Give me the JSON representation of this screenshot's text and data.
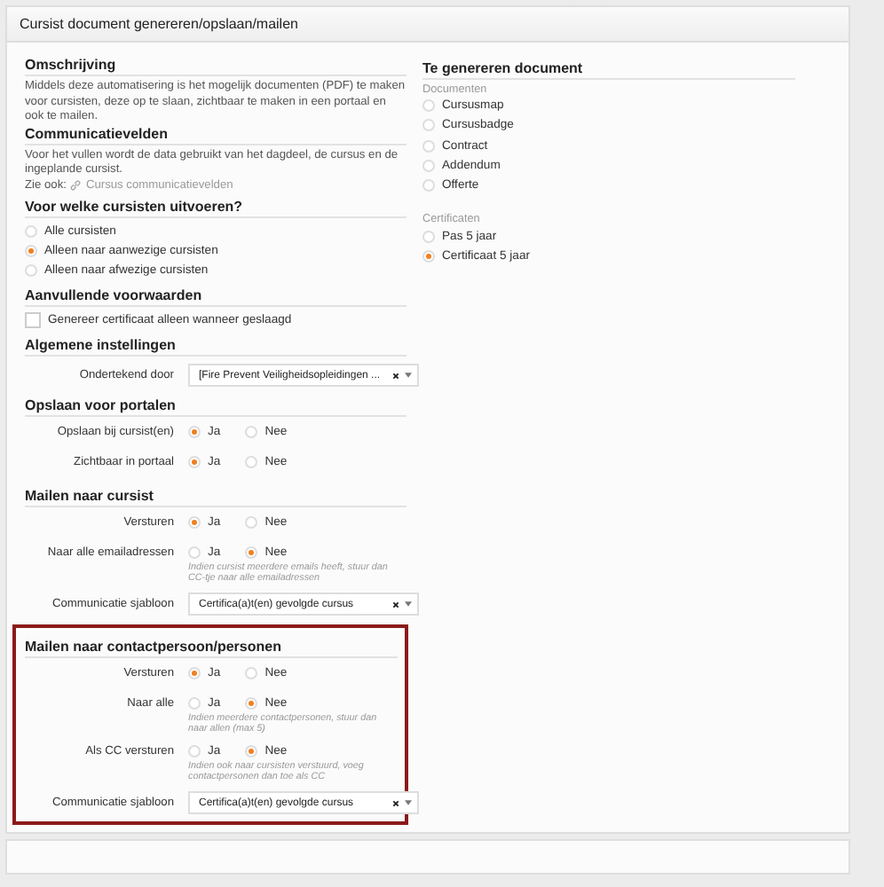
{
  "panel": {
    "title": "Cursist document genereren/opslaan/mailen"
  },
  "left": [
    {
      "kind": "text",
      "heading": "Omschrijving",
      "paragraph": "Middels deze automatisering is het mogelijk documenten (PDF) te maken voor cursisten, deze op te slaan, zichtbaar te maken in een portaal en ook te mailen."
    },
    {
      "kind": "text",
      "heading": "Communicatievelden",
      "paragraph": "Voor het vullen wordt de data gebruikt van het dagdeel, de cursus en de ingeplande cursist.",
      "see_also": {
        "label": "Zie ook:",
        "link": "Cursus communicatievelden"
      }
    },
    {
      "kind": "radios",
      "heading": "Voor welke cursisten uitvoeren?",
      "options": [
        {
          "label": "Alle cursisten",
          "selected": false
        },
        {
          "label": "Alleen naar aanwezige cursisten",
          "selected": true
        },
        {
          "label": "Alleen naar afwezige cursisten",
          "selected": false
        }
      ]
    },
    {
      "kind": "checkboxes",
      "heading": "Aanvullende voorwaarden",
      "items": [
        {
          "label": "Genereer certificaat alleen wanneer geslaagd",
          "checked": false
        }
      ]
    },
    {
      "kind": "form",
      "heading": "Algemene instellingen",
      "rows": [
        {
          "kind": "select",
          "label": "Ondertekend door",
          "value": "[Fire Prevent Veiligheidsopleidingen ..."
        }
      ]
    },
    {
      "kind": "form",
      "heading": "Opslaan voor portalen",
      "rows": [
        {
          "kind": "yesno",
          "label": "Opslaan bij cursist(en)",
          "options": [
            {
              "label": "Ja",
              "selected": true
            },
            {
              "label": "Nee",
              "selected": false
            }
          ]
        },
        {
          "kind": "yesno",
          "label": "Zichtbaar in portaal",
          "options": [
            {
              "label": "Ja",
              "selected": true
            },
            {
              "label": "Nee",
              "selected": false
            }
          ]
        }
      ]
    },
    {
      "kind": "form",
      "heading": "Mailen naar cursist",
      "rows": [
        {
          "kind": "yesno",
          "label": "Versturen",
          "options": [
            {
              "label": "Ja",
              "selected": true
            },
            {
              "label": "Nee",
              "selected": false
            }
          ]
        },
        {
          "kind": "yesno",
          "label": "Naar alle emailadressen",
          "options": [
            {
              "label": "Ja",
              "selected": false
            },
            {
              "label": "Nee",
              "selected": true
            }
          ],
          "note": "Indien cursist meerdere emails heeft, stuur dan CC-tje naar alle emailadressen"
        },
        {
          "kind": "select",
          "label": "Communicatie sjabloon",
          "value": "Certifica(a)t(en) gevolgde cursus"
        }
      ]
    },
    {
      "kind": "form",
      "heading": "Mailen naar contactpersoon/personen",
      "highlighted": true,
      "rows": [
        {
          "kind": "yesno",
          "label": "Versturen",
          "options": [
            {
              "label": "Ja",
              "selected": true
            },
            {
              "label": "Nee",
              "selected": false
            }
          ]
        },
        {
          "kind": "yesno",
          "label": "Naar alle",
          "options": [
            {
              "label": "Ja",
              "selected": false
            },
            {
              "label": "Nee",
              "selected": true
            }
          ],
          "note": "Indien meerdere contactpersonen, stuur dan naar allen (max 5)"
        },
        {
          "kind": "yesno",
          "label": "Als CC versturen",
          "options": [
            {
              "label": "Ja",
              "selected": false
            },
            {
              "label": "Nee",
              "selected": true
            }
          ],
          "note": "Indien ook naar cursisten verstuurd, voeg contactpersonen dan toe als CC"
        },
        {
          "kind": "select",
          "label": "Communicatie sjabloon",
          "value": "Certifica(a)t(en) gevolgde cursus"
        }
      ]
    }
  ],
  "right": {
    "heading": "Te genereren document",
    "groups": [
      {
        "label": "Documenten",
        "options": [
          {
            "label": "Cursusmap",
            "selected": false
          },
          {
            "label": "Cursusbadge",
            "selected": false
          },
          {
            "label": "Contract",
            "selected": false
          },
          {
            "label": "Addendum",
            "selected": false
          },
          {
            "label": "Offerte",
            "selected": false
          }
        ]
      },
      {
        "label": "Certificaten",
        "options": [
          {
            "label": "Pas 5 jaar",
            "selected": false
          },
          {
            "label": "Certificaat 5 jaar",
            "selected": true
          }
        ]
      }
    ]
  }
}
